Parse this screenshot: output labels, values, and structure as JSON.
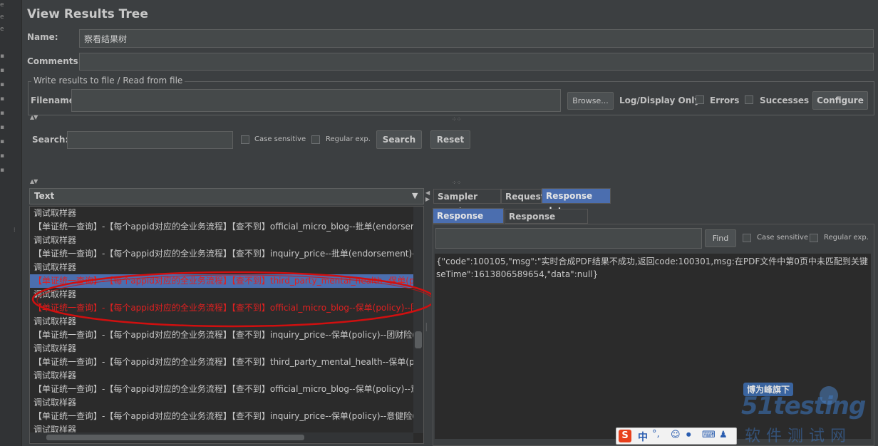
{
  "title": "View Results Tree",
  "name_label": "Name:",
  "name_value": "察看结果树",
  "comments_label": "Comments:",
  "comments_value": "",
  "file_group_legend": "Write results to file / Read from file",
  "filename_label": "Filename",
  "filename_value": "",
  "browse_label": "Browse...",
  "log_display_label": "Log/Display Only:",
  "errors_label": "Errors",
  "successes_label": "Successes",
  "configure_label": "Configure",
  "search": {
    "label": "Search:",
    "value": "",
    "case_sensitive_label": "Case sensitive",
    "regular_exp_label": "Regular exp.",
    "search_button": "Search",
    "reset_button": "Reset"
  },
  "tree": {
    "renderer_selected": "Text",
    "items": [
      {
        "text": "调试取样器",
        "status": "ok"
      },
      {
        "text": "【单证统一查询】-【每个appid对应的全业务流程】【查不到】official_micro_blog--批单(endorsem",
        "status": "ok"
      },
      {
        "text": "调试取样器",
        "status": "ok"
      },
      {
        "text": "【单证统一查询】-【每个appid对应的全业务流程】【查不到】inquiry_price--批单(endorsement)--臣",
        "status": "ok"
      },
      {
        "text": "调试取样器",
        "status": "ok"
      },
      {
        "text": "【单证统一查询】-【每个appid对应的全业务流程】【查不到】third_party_mental_health--保单(poli",
        "status": "error",
        "selected": true
      },
      {
        "text": "调试取样器",
        "status": "ok"
      },
      {
        "text": "【单证统一查询】-【每个appid对应的全业务流程】【查不到】official_micro_blog--保单(policy)--团",
        "status": "error"
      },
      {
        "text": "调试取样器",
        "status": "ok"
      },
      {
        "text": "【单证统一查询】-【每个appid对应的全业务流程】【查不到】inquiry_price--保单(policy)--团财险(g",
        "status": "ok"
      },
      {
        "text": "调试取样器",
        "status": "ok"
      },
      {
        "text": "【单证统一查询】-【每个appid对应的全业务流程】【查不到】third_party_mental_health--保单(pol",
        "status": "ok"
      },
      {
        "text": "调试取样器",
        "status": "ok"
      },
      {
        "text": "【单证统一查询】-【每个appid对应的全业务流程】【查不到】official_micro_blog--保单(policy)--意",
        "status": "ok"
      },
      {
        "text": "调试取样器",
        "status": "ok"
      },
      {
        "text": "【单证统一查询】-【每个appid对应的全业务流程】【查不到】inquiry_price--保单(policy)--意健险(m",
        "status": "ok"
      },
      {
        "text": "调试取样器",
        "status": "ok"
      }
    ]
  },
  "result_tabs": [
    "Sampler result",
    "Request",
    "Response data"
  ],
  "response_subtabs": [
    "Response Body",
    "Response headers"
  ],
  "find": {
    "value": "",
    "find_button": "Find",
    "case_sensitive_label": "Case sensitive",
    "regular_exp_label": "Regular exp."
  },
  "response_body": {
    "line1": "{\"code\":100105,\"msg\":\"实时合成PDF结果不成功,返回code:100301,msg:在PDF文件中第0页中未匹配到关键字:(",
    "line2": "seTime\":1613806589654,\"data\":null}"
  },
  "watermark": {
    "tag": "博为峰旗下",
    "brand": "51testing",
    "subtitle": "软件测试网"
  },
  "ime_toolbar": {
    "char": "中"
  },
  "colors": {
    "background": "#3c3f41",
    "selection": "#4b6eaf",
    "error_text": "#e02020",
    "annotation_ellipse": "#d01010"
  }
}
